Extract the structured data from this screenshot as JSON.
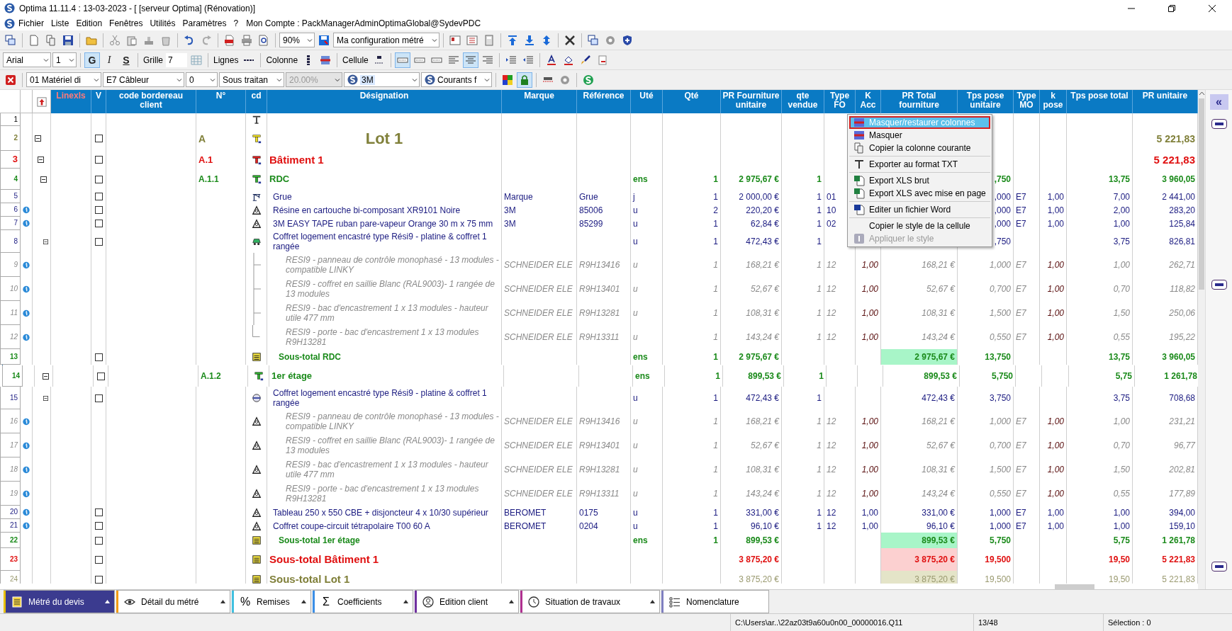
{
  "window": {
    "title": "Optima 11.11.4 : 13-03-2023 - [ [serveur Optima] (Rénovation)]"
  },
  "menu": [
    "Fichier",
    "Liste",
    "Edition",
    "Fenêtres",
    "Utilités",
    "Paramètres",
    "?"
  ],
  "account": "Mon Compte : PackManagerAdminOptimaGlobal@SydevPDC",
  "toolbar": {
    "zoom": "90%",
    "configuration": "Ma configuration métré",
    "font": "Arial",
    "font_size": "1",
    "format_buttons": [
      {
        "label": "G",
        "on": true
      },
      {
        "label": "I",
        "on": false
      },
      {
        "label": "S",
        "on": false
      }
    ],
    "grid_label": "Grille",
    "grid_value": "7",
    "lines_label": "Lignes",
    "columns_label": "Colonne",
    "cell_label": "Cellule",
    "line_buttons": [
      {
        "on": true
      },
      {
        "on": false
      },
      {
        "on": false
      }
    ],
    "align_buttons": [
      {
        "on": false
      },
      {
        "on": true
      },
      {
        "on": false
      }
    ],
    "filters": [
      {
        "value": "01 Matériel di",
        "disabled": false
      },
      {
        "value": "E7 Câbleur",
        "disabled": false
      },
      {
        "value": "0",
        "disabled": false
      },
      {
        "value": "Sous traitan",
        "disabled": false
      },
      {
        "value": "20.00%",
        "disabled": true
      },
      {
        "value": "3M",
        "disabled": false
      },
      {
        "value": "Courants f",
        "disabled": false
      }
    ],
    "lock_on": true
  },
  "table": {
    "columns": [
      "Linexls",
      "V",
      "code bordereau client",
      "N°",
      "cd",
      "Désignation",
      "Marque",
      "Référence",
      "Uté",
      "Qté",
      "PR Fourniture unitaire",
      "qte vendue",
      "Type FO",
      "K Acc",
      "PR Total fourniture",
      "Tps pose unitaire",
      "Type MO",
      "k pose",
      "Tps pose total",
      "PR unitaire"
    ],
    "rows": [
      {
        "row": "1",
        "kind": "text",
        "info": false
      },
      {
        "row": "2",
        "kind": "lot",
        "info": false,
        "checked": false,
        "expanded": true,
        "cells": {
          "numero": "A",
          "designation": "Lot 1",
          "pr_unitaire": "5 221,83"
        },
        "children": [
          {
            "row": "3",
            "kind": "batiment",
            "info": false,
            "checked": false,
            "expanded": true,
            "cells": {
              "numero": "A.1",
              "designation": "Bâtiment 1",
              "pr_unitaire": "5 221,83"
            },
            "children": [
              {
                "row": "4",
                "kind": "niveau",
                "info": false,
                "checked": false,
                "expanded": true,
                "cells": {
                  "numero": "A.1.1",
                  "designation": "RDC",
                  "ute": "ens",
                  "qte": "1",
                  "pr_fourniture": "2 975,67 €",
                  "qte_vendue": "1",
                  "tps_unit": ",750",
                  "tps_total": "13,75",
                  "pr_unitaire": "3 960,05"
                },
                "children": [
                  {
                    "row": "5",
                    "kind": "crane",
                    "info": false,
                    "checked": false,
                    "cells": {
                      "designation": "Grue",
                      "marque": "Marque",
                      "reference": "Grue",
                      "ute": "j",
                      "qte": "1",
                      "pr_fourniture": "2 000,00 €",
                      "qte_vendue": "1",
                      "type_fo": "01",
                      "tps_unit": ",000",
                      "type_mo": "E7",
                      "k_pose": "1,00",
                      "tps_total": "7,00",
                      "pr_unitaire": "2 441,00"
                    }
                  },
                  {
                    "row": "6",
                    "kind": "article",
                    "info": true,
                    "checked": false,
                    "cells": {
                      "designation": "Résine en cartouche bi-composant XR9101 Noire",
                      "marque": "3M",
                      "reference": "85006",
                      "ute": "u",
                      "qte": "2",
                      "pr_fourniture": "220,20 €",
                      "qte_vendue": "1",
                      "type_fo": "10",
                      "tps_unit": ",000",
                      "type_mo": "E7",
                      "k_pose": "1,00",
                      "tps_total": "2,00",
                      "pr_unitaire": "283,20"
                    }
                  },
                  {
                    "row": "7",
                    "kind": "article",
                    "info": true,
                    "checked": false,
                    "cells": {
                      "designation": "3M EASY TAPE ruban pare-vapeur Orange 30 m x 75 mm",
                      "marque": "3M",
                      "reference": "85299",
                      "ute": "u",
                      "qte": "1",
                      "pr_fourniture": "62,84 €",
                      "qte_vendue": "1",
                      "type_fo": "02",
                      "tps_unit": ",000",
                      "type_mo": "E7",
                      "k_pose": "1,00",
                      "tps_total": "1,00",
                      "pr_unitaire": "125,84"
                    }
                  },
                  {
                    "row": "8",
                    "kind": "vehicle",
                    "info": false,
                    "checked": false,
                    "expanded": true,
                    "cells": {
                      "designation": "Coffret logement encastré type Rési9 - platine & coffret 1 rangée",
                      "ute": "u",
                      "qte": "1",
                      "pr_fourniture": "472,43 €",
                      "qte_vendue": "1",
                      "tps_unit": ",750",
                      "tps_total": "3,75",
                      "pr_unitaire": "826,81"
                    },
                    "children": [
                      {
                        "row": "9",
                        "kind": "component-linked",
                        "info": true,
                        "cells": {
                          "designation": "RESI9 - panneau de contrôle monophasé - 13 modules - compatible LINKY",
                          "marque": "SCHNEIDER ELE",
                          "reference": "R9H13416",
                          "ute": "u",
                          "qte": "1",
                          "pr_fourniture": "168,21 €",
                          "qte_vendue": "1",
                          "type_fo": "12",
                          "k_acc": "1,00",
                          "pr_total": "168,21 €",
                          "tps_unit": "1,000",
                          "type_mo": "E7",
                          "k_pose": "1,00",
                          "tps_total": "1,00",
                          "pr_unitaire": "262,71"
                        }
                      },
                      {
                        "row": "10",
                        "kind": "component-linked",
                        "info": true,
                        "cells": {
                          "designation": "RESI9 - coffret en saillie Blanc (RAL9003)- 1 rangée de 13 modules",
                          "marque": "SCHNEIDER ELE",
                          "reference": "R9H13401",
                          "ute": "u",
                          "qte": "1",
                          "pr_fourniture": "52,67 €",
                          "qte_vendue": "1",
                          "type_fo": "12",
                          "k_acc": "1,00",
                          "pr_total": "52,67 €",
                          "tps_unit": "0,700",
                          "type_mo": "E7",
                          "k_pose": "1,00",
                          "tps_total": "0,70",
                          "pr_unitaire": "118,82"
                        }
                      },
                      {
                        "row": "11",
                        "kind": "component-linked",
                        "info": true,
                        "cells": {
                          "designation": "RESI9 - bac d'encastrement 1 x 13 modules - hauteur utile 477 mm",
                          "marque": "SCHNEIDER ELE",
                          "reference": "R9H13281",
                          "ute": "u",
                          "qte": "1",
                          "pr_fourniture": "108,31 €",
                          "qte_vendue": "1",
                          "type_fo": "12",
                          "k_acc": "1,00",
                          "pr_total": "108,31 €",
                          "tps_unit": "1,500",
                          "type_mo": "E7",
                          "k_pose": "1,00",
                          "tps_total": "1,50",
                          "pr_unitaire": "250,06"
                        }
                      },
                      {
                        "row": "12",
                        "kind": "component-linked-end",
                        "info": true,
                        "cells": {
                          "designation": "RESI9 - porte - bac d'encastrement 1 x 13 modules R9H13281",
                          "marque": "SCHNEIDER ELE",
                          "reference": "R9H13311",
                          "ute": "u",
                          "qte": "1",
                          "pr_fourniture": "143,24 €",
                          "qte_vendue": "1",
                          "type_fo": "12",
                          "k_acc": "1,00",
                          "pr_total": "143,24 €",
                          "tps_unit": "0,550",
                          "type_mo": "E7",
                          "k_pose": "1,00",
                          "tps_total": "0,55",
                          "pr_unitaire": "195,22"
                        }
                      }
                    ]
                  },
                  {
                    "row": "13",
                    "kind": "subtotal-niveau",
                    "info": false,
                    "checked": false,
                    "cells": {
                      "designation": "Sous-total RDC",
                      "ute": "ens",
                      "qte": "1",
                      "pr_fourniture": "2 975,67 €",
                      "pr_total": "2 975,67 €",
                      "tps_unit": "13,750",
                      "tps_total": "13,75",
                      "pr_unitaire": "3 960,05"
                    }
                  }
                ]
              },
              {
                "row": "14",
                "kind": "niveau",
                "info": false,
                "checked": false,
                "expanded": true,
                "cells": {
                  "numero": "A.1.2",
                  "designation": "1er étage",
                  "ute": "ens",
                  "qte": "1",
                  "pr_fourniture": "899,53 €",
                  "qte_vendue": "1",
                  "pr_total": "899,53 €",
                  "tps_unit": "5,750",
                  "tps_total": "5,75",
                  "pr_unitaire": "1 261,78"
                },
                "children": [
                  {
                    "row": "15",
                    "kind": "assembly",
                    "info": false,
                    "checked": false,
                    "expanded": true,
                    "cells": {
                      "designation": "Coffret logement encastré type Rési9 - platine & coffret 1 rangée",
                      "ute": "u",
                      "qte": "1",
                      "pr_fourniture": "472,43 €",
                      "qte_vendue": "1",
                      "pr_total": "472,43 €",
                      "tps_unit": "3,750",
                      "tps_total": "3,75",
                      "pr_unitaire": "708,68"
                    },
                    "children": [
                      {
                        "row": "16",
                        "kind": "component",
                        "info": true,
                        "cells": {
                          "designation": "RESI9 - panneau de contrôle monophasé - 13 modules - compatible LINKY",
                          "marque": "SCHNEIDER ELE",
                          "reference": "R9H13416",
                          "ute": "u",
                          "qte": "1",
                          "pr_fourniture": "168,21 €",
                          "qte_vendue": "1",
                          "type_fo": "12",
                          "k_acc": "1,00",
                          "pr_total": "168,21 €",
                          "tps_unit": "1,000",
                          "type_mo": "E7",
                          "k_pose": "1,00",
                          "tps_total": "1,00",
                          "pr_unitaire": "231,21"
                        }
                      },
                      {
                        "row": "17",
                        "kind": "component",
                        "info": true,
                        "cells": {
                          "designation": "RESI9 - coffret en saillie Blanc (RAL9003)- 1 rangée de 13 modules",
                          "marque": "SCHNEIDER ELE",
                          "reference": "R9H13401",
                          "ute": "u",
                          "qte": "1",
                          "pr_fourniture": "52,67 €",
                          "qte_vendue": "1",
                          "type_fo": "12",
                          "k_acc": "1,00",
                          "pr_total": "52,67 €",
                          "tps_unit": "0,700",
                          "type_mo": "E7",
                          "k_pose": "1,00",
                          "tps_total": "0,70",
                          "pr_unitaire": "96,77"
                        }
                      },
                      {
                        "row": "18",
                        "kind": "component",
                        "info": true,
                        "cells": {
                          "designation": "RESI9 - bac d'encastrement 1 x 13 modules - hauteur utile 477 mm",
                          "marque": "SCHNEIDER ELE",
                          "reference": "R9H13281",
                          "ute": "u",
                          "qte": "1",
                          "pr_fourniture": "108,31 €",
                          "qte_vendue": "1",
                          "type_fo": "12",
                          "k_acc": "1,00",
                          "pr_total": "108,31 €",
                          "tps_unit": "1,500",
                          "type_mo": "E7",
                          "k_pose": "1,00",
                          "tps_total": "1,50",
                          "pr_unitaire": "202,81"
                        }
                      },
                      {
                        "row": "19",
                        "kind": "component",
                        "info": true,
                        "cells": {
                          "designation": "RESI9 - porte - bac d'encastrement 1 x 13 modules R9H13281",
                          "marque": "SCHNEIDER ELE",
                          "reference": "R9H13311",
                          "ute": "u",
                          "qte": "1",
                          "pr_fourniture": "143,24 €",
                          "qte_vendue": "1",
                          "type_fo": "12",
                          "k_acc": "1,00",
                          "pr_total": "143,24 €",
                          "tps_unit": "0,550",
                          "type_mo": "E7",
                          "k_pose": "1,00",
                          "tps_total": "0,55",
                          "pr_unitaire": "177,89"
                        }
                      }
                    ]
                  },
                  {
                    "row": "20",
                    "kind": "article",
                    "info": true,
                    "checked": false,
                    "cells": {
                      "designation": "Tableau 250 x 550 CBE + disjoncteur 4 x 10/30 supérieur",
                      "marque": "BEROMET",
                      "reference": "0175",
                      "ute": "u",
                      "qte": "1",
                      "pr_fourniture": "331,00 €",
                      "qte_vendue": "1",
                      "type_fo": "12",
                      "k_acc": "1,00",
                      "pr_total": "331,00 €",
                      "tps_unit": "1,000",
                      "type_mo": "E7",
                      "k_pose": "1,00",
                      "tps_total": "1,00",
                      "pr_unitaire": "394,00"
                    }
                  },
                  {
                    "row": "21",
                    "kind": "article",
                    "info": true,
                    "checked": false,
                    "cells": {
                      "designation": "Coffret coupe-circuit tétrapolaire T00 60 A",
                      "marque": "BEROMET",
                      "reference": "0204",
                      "ute": "u",
                      "qte": "1",
                      "pr_fourniture": "96,10 €",
                      "qte_vendue": "1",
                      "type_fo": "12",
                      "k_acc": "1,00",
                      "pr_total": "96,10 €",
                      "tps_unit": "1,000",
                      "type_mo": "E7",
                      "k_pose": "1,00",
                      "tps_total": "1,00",
                      "pr_unitaire": "159,10"
                    }
                  },
                  {
                    "row": "22",
                    "kind": "subtotal-niveau",
                    "info": false,
                    "checked": false,
                    "cells": {
                      "designation": "Sous-total 1er étage",
                      "ute": "ens",
                      "qte": "1",
                      "pr_fourniture": "899,53 €",
                      "pr_total": "899,53 €",
                      "tps_unit": "5,750",
                      "tps_total": "5,75",
                      "pr_unitaire": "1 261,78"
                    }
                  }
                ]
              },
              {
                "row": "23",
                "kind": "subtotal-batiment",
                "info": false,
                "checked": false,
                "cells": {
                  "designation": "Sous-total Bâtiment 1",
                  "pr_fourniture": "3 875,20 €",
                  "pr_total": "3 875,20 €",
                  "tps_unit": "19,500",
                  "tps_total": "19,50",
                  "pr_unitaire": "5 221,83"
                }
              }
            ]
          },
          {
            "row": "24",
            "kind": "subtotal-lot",
            "info": false,
            "checked": false,
            "cells": {
              "designation": "Sous-total Lot 1",
              "pr_fourniture": "3 875,20 €",
              "pr_total": "3 875,20 €",
              "tps_unit": "19,500",
              "tps_total": "19,50",
              "pr_unitaire": "5 221,83"
            }
          }
        ]
      }
    ]
  },
  "context_menu": [
    {
      "kind": "item",
      "label": "Masquer/restaurer colonnes",
      "selected": true,
      "disabled": false
    },
    {
      "kind": "item",
      "label": "Masquer",
      "selected": false,
      "disabled": false
    },
    {
      "kind": "item",
      "label": "Copier la colonne courante",
      "selected": false,
      "disabled": false
    },
    {
      "kind": "separator"
    },
    {
      "kind": "item",
      "label": "Exporter au format TXT",
      "selected": false,
      "disabled": false
    },
    {
      "kind": "separator"
    },
    {
      "kind": "item",
      "label": "Export XLS brut",
      "selected": false,
      "disabled": false
    },
    {
      "kind": "item",
      "label": "Export XLS avec mise en page",
      "selected": false,
      "disabled": false
    },
    {
      "kind": "separator"
    },
    {
      "kind": "item",
      "label": "Editer un fichier Word",
      "selected": false,
      "disabled": false
    },
    {
      "kind": "separator"
    },
    {
      "kind": "item",
      "label": "Copier le style de la cellule",
      "selected": false,
      "disabled": false
    },
    {
      "kind": "item",
      "label": "Appliquer le style",
      "selected": false,
      "disabled": true
    }
  ],
  "side_panel": {
    "collapse_label": "«"
  },
  "tabs": [
    {
      "label": "Métré du devis",
      "selected": true,
      "has_menu": true,
      "color": "#e8c000"
    },
    {
      "label": "Détail du métré",
      "selected": false,
      "has_menu": true,
      "color": "#f39c12"
    },
    {
      "label": "Remises",
      "glyph": "%",
      "selected": false,
      "has_menu": true,
      "color": "#40c0e0"
    },
    {
      "label": "Coefficients",
      "glyph": "Σ",
      "selected": false,
      "has_menu": true,
      "color": "#3a8ee6"
    },
    {
      "label": "Edition client",
      "selected": false,
      "has_menu": true,
      "color": "#7030a0"
    },
    {
      "label": "Situation de travaux",
      "selected": false,
      "has_menu": true,
      "color": "#b03090"
    },
    {
      "label": "Nomenclature",
      "selected": false,
      "has_menu": false,
      "color": "#8080c0"
    }
  ],
  "status_bar": {
    "path": "C:\\Users\\ar..\\22az03t9a60u0n00_00000016.Q11",
    "position": "13/48",
    "selection": "Sélection : 0"
  }
}
